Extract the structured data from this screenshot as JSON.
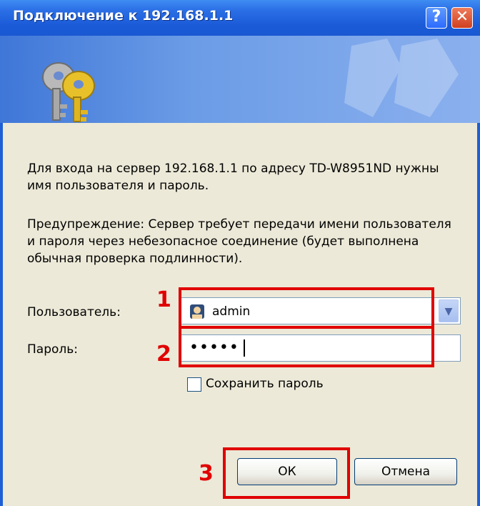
{
  "window": {
    "title": "Подключение к 192.168.1.1"
  },
  "titlebar_buttons": {
    "help": "?",
    "close": "✕"
  },
  "message": {
    "line1": "Для входа на сервер 192.168.1.1 по адресу TD-W8951ND нужны имя пользователя и пароль.",
    "warning": "Предупреждение: Сервер требует передачи имени пользователя и пароля через небезопасное соединение (будет выполнена обычная проверка подлинности)."
  },
  "form": {
    "user_label": "Пользователь:",
    "user_value": "admin",
    "password_label": "Пароль:",
    "password_masked": "•••••",
    "save_password_label": "Сохранить пароль"
  },
  "buttons": {
    "ok": "ОК",
    "cancel": "Отмена"
  },
  "annotations": [
    "1",
    "2",
    "3"
  ],
  "colors": {
    "titlebar": "#1b5bd8",
    "dialog_bg": "#ece9d8",
    "highlight": "#e00000"
  }
}
